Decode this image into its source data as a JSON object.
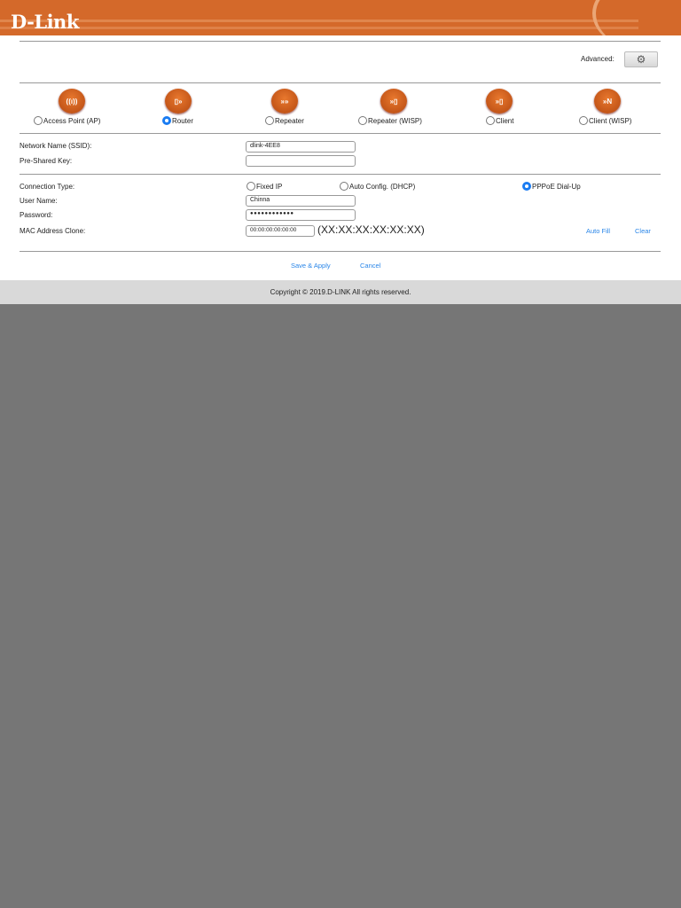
{
  "brand": {
    "logo": "D-Link"
  },
  "advanced": {
    "label": "Advanced:",
    "icon": "gear-icon"
  },
  "modes": [
    {
      "label": "Access Point (AP)",
      "selected": false,
      "glyph": "((ı))"
    },
    {
      "label": "Router",
      "selected": true,
      "glyph": "▯»"
    },
    {
      "label": "Repeater",
      "selected": false,
      "glyph": "»»"
    },
    {
      "label": "Repeater (WISP)",
      "selected": false,
      "glyph": "»▯"
    },
    {
      "label": "Client",
      "selected": false,
      "glyph": "»▯"
    },
    {
      "label": "Client (WISP)",
      "selected": false,
      "glyph": "»N"
    }
  ],
  "wireless": {
    "ssid_label": "Network Name (SSID):",
    "ssid_value": "dlink-4EE8",
    "psk_label": "Pre-Shared Key:",
    "psk_value": ""
  },
  "wan": {
    "connection_label": "Connection Type:",
    "types": [
      {
        "label": "Fixed IP",
        "selected": false
      },
      {
        "label": "Auto Config. (DHCP)",
        "selected": false
      },
      {
        "label": "PPPoE Dial-Up",
        "selected": true
      }
    ],
    "user_label": "User Name:",
    "user_value": "Chinna",
    "password_label": "Password:",
    "password_value": "●●●●●●●●●●●●",
    "mac_label": "MAC Address Clone:",
    "mac_value": "00:00:00:00:00:00",
    "mac_format": "(XX:XX:XX:XX:XX:XX)",
    "auto_fill": "Auto Fill",
    "clear": "Clear"
  },
  "actions": {
    "save": "Save & Apply",
    "cancel": "Cancel"
  },
  "footer": {
    "copyright": "Copyright © 2019.D-LINK All rights reserved."
  }
}
